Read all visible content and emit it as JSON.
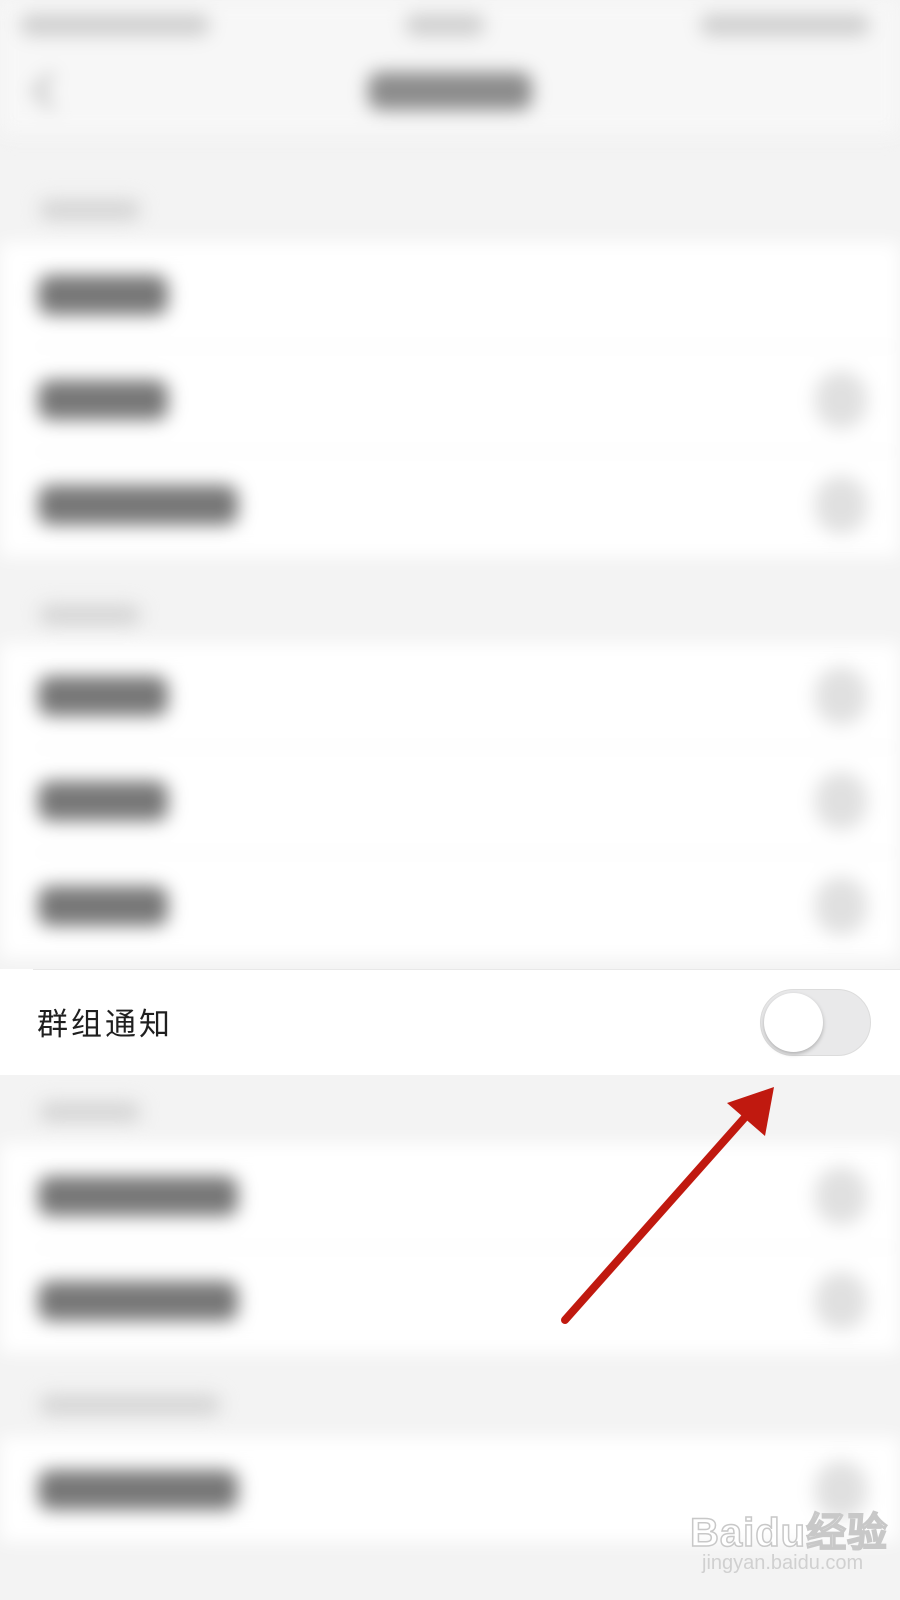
{
  "group_notification": {
    "label": "群组通知",
    "toggle_on": false
  },
  "watermark": {
    "brand": "Baidu经验",
    "domain": "jingyan.baidu.com"
  },
  "colors": {
    "arrow": "#c0190f",
    "toggle_track_off": "#e9e9ea",
    "toggle_knob": "#ffffff"
  },
  "icons": [
    "back-arrow-icon",
    "toggle-switch"
  ]
}
